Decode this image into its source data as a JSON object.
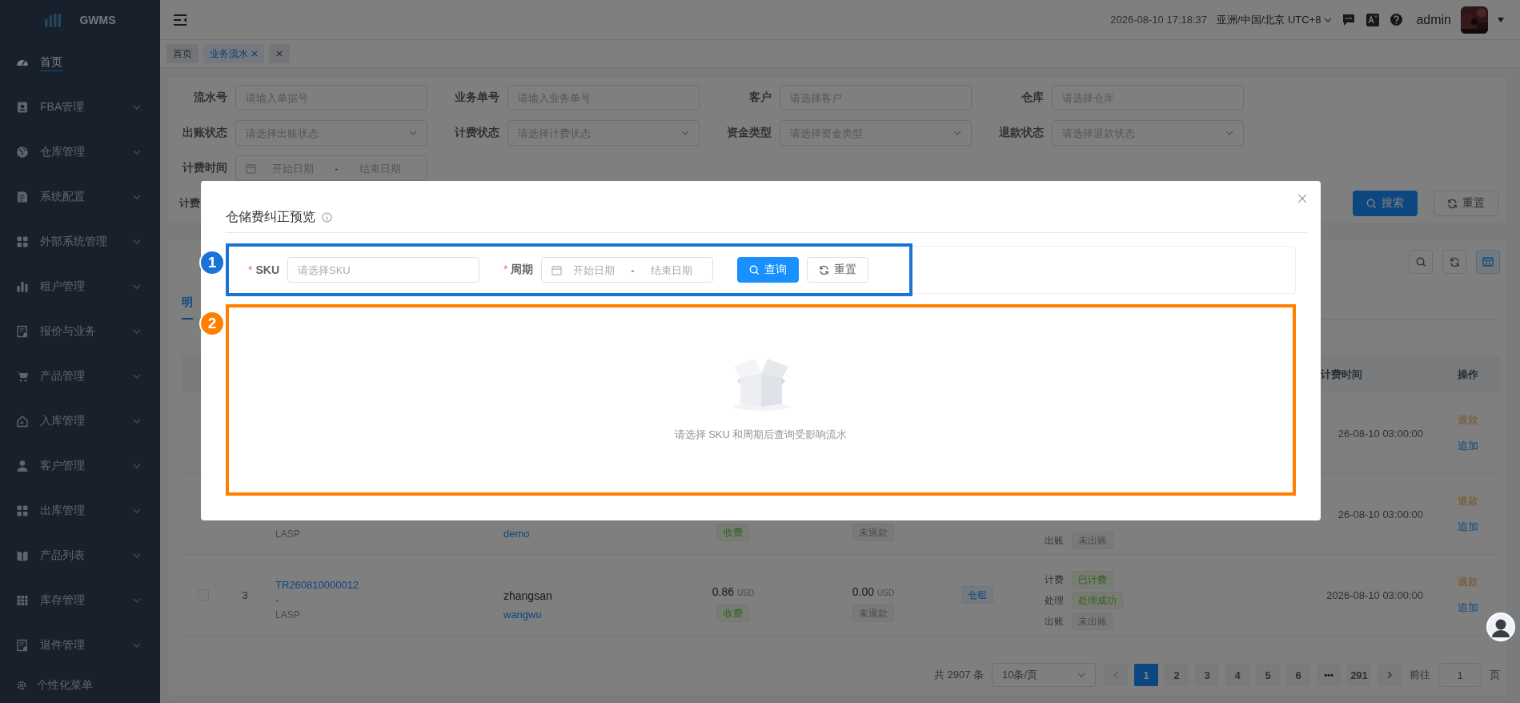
{
  "sidebar": {
    "logo": "GWMS",
    "items": [
      {
        "label": "首页",
        "selected": true,
        "submenu": false
      },
      {
        "label": "FBA管理",
        "selected": false,
        "submenu": true
      },
      {
        "label": "仓库管理",
        "selected": false,
        "submenu": true
      },
      {
        "label": "系统配置",
        "selected": false,
        "submenu": true
      },
      {
        "label": "外部系统管理",
        "selected": false,
        "submenu": true
      },
      {
        "label": "租户管理",
        "selected": false,
        "submenu": true
      },
      {
        "label": "报价与业务",
        "selected": false,
        "submenu": true
      },
      {
        "label": "产品管理",
        "selected": false,
        "submenu": true
      },
      {
        "label": "入库管理",
        "selected": false,
        "submenu": true
      },
      {
        "label": "客户管理",
        "selected": false,
        "submenu": true
      },
      {
        "label": "出库管理",
        "selected": false,
        "submenu": true
      },
      {
        "label": "产品列表",
        "selected": false,
        "submenu": true
      },
      {
        "label": "库存管理",
        "selected": false,
        "submenu": true
      },
      {
        "label": "退件管理",
        "selected": false,
        "submenu": true
      }
    ],
    "footer": "个性化菜单"
  },
  "header": {
    "datetime": "2026-08-10 17:18:37",
    "timezone": "亚洲/中国/北京 UTC+8",
    "user": "admin"
  },
  "tags": [
    {
      "label": "首页",
      "selected": false,
      "closable": false
    },
    {
      "label": "业务流水",
      "selected": true,
      "closable": true
    }
  ],
  "filters": {
    "fields": [
      {
        "label": "流水号",
        "kind": "input",
        "placeholder": "请输入单据号"
      },
      {
        "label": "业务单号",
        "kind": "input",
        "placeholder": "请输入业务单号"
      },
      {
        "label": "客户",
        "kind": "input",
        "placeholder": "请选择客户"
      },
      {
        "label": "仓库",
        "kind": "input",
        "placeholder": "请选择仓库"
      },
      {
        "label": "出账状态",
        "kind": "select",
        "placeholder": "请选择出账状态"
      },
      {
        "label": "计费状态",
        "kind": "select",
        "placeholder": "请选择计费状态"
      },
      {
        "label": "资金类型",
        "kind": "select",
        "placeholder": "请选择资金类型"
      },
      {
        "label": "退款状态",
        "kind": "select",
        "placeholder": "请选择退款状态"
      },
      {
        "label": "计费时间",
        "kind": "daterange",
        "start_placeholder": "开始日期",
        "separator": "-",
        "end_placeholder": "结束日期"
      }
    ],
    "last_label": "计费",
    "buttons": [
      {
        "label": "搜索",
        "kind": "primary"
      },
      {
        "label": "重置",
        "kind": "default"
      }
    ]
  },
  "table_card": {
    "tab": "明",
    "columns": [
      {
        "label": "计费时间"
      },
      {
        "label": "操作"
      }
    ],
    "rows": [
      {
        "time": "26-08-10 03:00:00",
        "actions": [
          {
            "label": "退款",
            "kind": "warning"
          },
          {
            "label": "追加",
            "kind": "primary"
          }
        ]
      },
      {
        "code_sub": "LASP",
        "operator": "demo",
        "amount_tag": "收费",
        "refund_tag": "未退款",
        "statuses": [
          {
            "label": "出账",
            "value": "未出账",
            "kind": "info"
          }
        ],
        "time": "26-08-10 03:00:00",
        "actions": [
          {
            "label": "退款",
            "kind": "warning"
          },
          {
            "label": "追加",
            "kind": "primary"
          }
        ]
      },
      {
        "checked": false,
        "index": "3",
        "code": "TR260810000012",
        "code_dash": "-",
        "code_sub": "LASP",
        "customer": "zhangsan",
        "operator": "wangwu",
        "amount": "0.86",
        "amount_currency": "USD",
        "amount_tag": "收费",
        "refund": "0.00",
        "refund_currency": "USD",
        "refund_tag": "未退款",
        "type_tag": "仓租",
        "statuses": [
          {
            "label": "计费",
            "value": "已计费",
            "kind": "success"
          },
          {
            "label": "处理",
            "value": "处理成功",
            "kind": "success"
          },
          {
            "label": "出账",
            "value": "未出账",
            "kind": "info"
          }
        ],
        "time": "2026-08-10 03:00:00",
        "actions": [
          {
            "label": "退款",
            "kind": "warning"
          },
          {
            "label": "追加",
            "kind": "primary"
          }
        ]
      }
    ],
    "pagination": {
      "total": "共 2907 条",
      "page_size": "10条/页",
      "pages": [
        {
          "label": "1",
          "selected": true,
          "kind": "page"
        },
        {
          "label": "2",
          "selected": false,
          "kind": "page"
        },
        {
          "label": "3",
          "selected": false,
          "kind": "page"
        },
        {
          "label": "4",
          "selected": false,
          "kind": "page"
        },
        {
          "label": "5",
          "selected": false,
          "kind": "page"
        },
        {
          "label": "6",
          "selected": false,
          "kind": "page"
        },
        {
          "label": "•••",
          "selected": false,
          "kind": "more"
        },
        {
          "label": "291",
          "selected": false,
          "kind": "page"
        }
      ],
      "goto_label": "前往",
      "goto_value": "1",
      "goto_suffix": "页"
    }
  },
  "modal": {
    "title": "仓储费纠正预览",
    "fields": [
      {
        "label": "SKU",
        "required_mark": "*",
        "kind": "input",
        "placeholder": "请选择SKU"
      },
      {
        "label": "周期",
        "required_mark": "*",
        "kind": "daterange",
        "start_placeholder": "开始日期",
        "separator": "-",
        "end_placeholder": "结束日期"
      }
    ],
    "buttons": [
      {
        "label": "查询",
        "kind": "primary"
      },
      {
        "label": "重置",
        "kind": "default"
      }
    ],
    "empty_text": "请选择 SKU 和周期后查询受影响流水"
  },
  "annotations": [
    {
      "number": "1",
      "color": "#1a73d9"
    },
    {
      "number": "2",
      "color": "#ff8000"
    }
  ]
}
